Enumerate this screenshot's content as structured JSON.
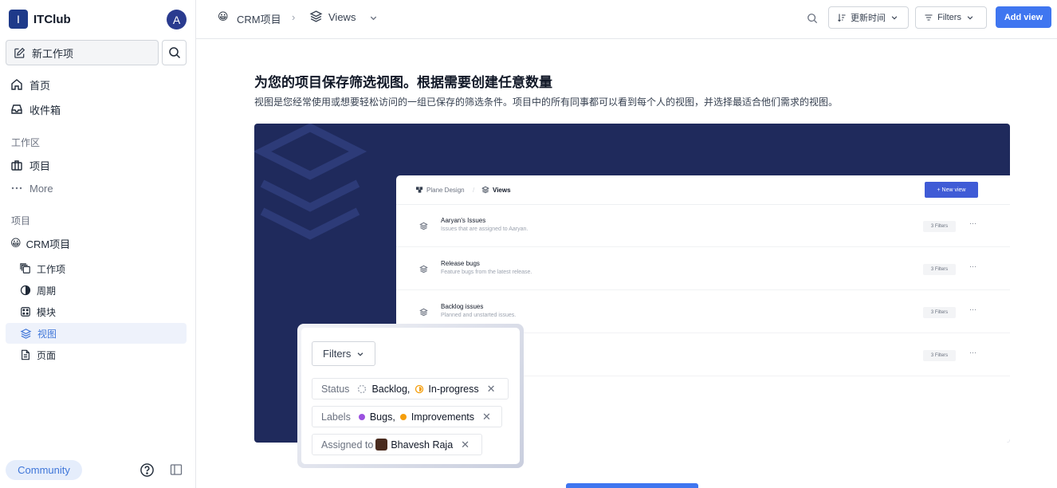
{
  "workspace": {
    "initial": "I",
    "name": "ITClub",
    "avatar": "A"
  },
  "sidebar": {
    "new_item": "新工作项",
    "nav": [
      {
        "label": "首页"
      },
      {
        "label": "收件箱"
      }
    ],
    "workspace_section": "工作区",
    "workspace_items": [
      {
        "label": "项目"
      },
      {
        "label": "More"
      }
    ],
    "projects_section": "项目",
    "project": {
      "emoji": "😀",
      "name": "CRM项目"
    },
    "project_items": [
      {
        "label": "工作项"
      },
      {
        "label": "周期"
      },
      {
        "label": "模块"
      },
      {
        "label": "视图",
        "active": true
      },
      {
        "label": "页面"
      }
    ],
    "community": "Community"
  },
  "header": {
    "project_emoji": "😀",
    "project": "CRM项目",
    "separator": "›",
    "page": "Views",
    "sort_label": "更新时间",
    "filters_label": "Filters",
    "add_view": "Add view"
  },
  "main": {
    "title": "为您的项目保存筛选视图。根据需要创建任意数量",
    "description": "视图是您经常使用或想要轻松访问的一组已保存的筛选条件。项目中的所有同事都可以看到每个人的视图，并选择最适合他们需求的视图。"
  },
  "illustration": {
    "breadcrumb_1": "Plane Design",
    "breadcrumb_sep": "/",
    "breadcrumb_2": "Views",
    "new_view": "+ New view",
    "rows": [
      {
        "name": "Aaryan's Issues",
        "sub": "Issues that are assigned to Aaryan.",
        "badge": "3 Filters"
      },
      {
        "name": "Release bugs",
        "sub": "Feature bugs from the latest release.",
        "badge": "3 Filters"
      },
      {
        "name": "Backlog issues",
        "sub": "Planned and unstarted issues.",
        "badge": "3 Filters"
      },
      {
        "name": "",
        "sub": "",
        "badge": "3 Filters"
      }
    ],
    "filters_button": "Filters",
    "status_key": "Status",
    "status_val_1": "Backlog,",
    "status_val_2": "In-progress",
    "labels_key": "Labels",
    "labels_val_1": "Bugs,",
    "labels_val_2": "Improvements",
    "assigned_key": "Assigned to",
    "assigned_val": "Bhavesh Raja",
    "remove_glyph": "✕",
    "more_glyph": "···",
    "colors": {
      "bugs": "#9b51e0",
      "improvements": "#f59e0b",
      "banner": "#1f2a5c",
      "accent": "#3f76f0"
    }
  }
}
